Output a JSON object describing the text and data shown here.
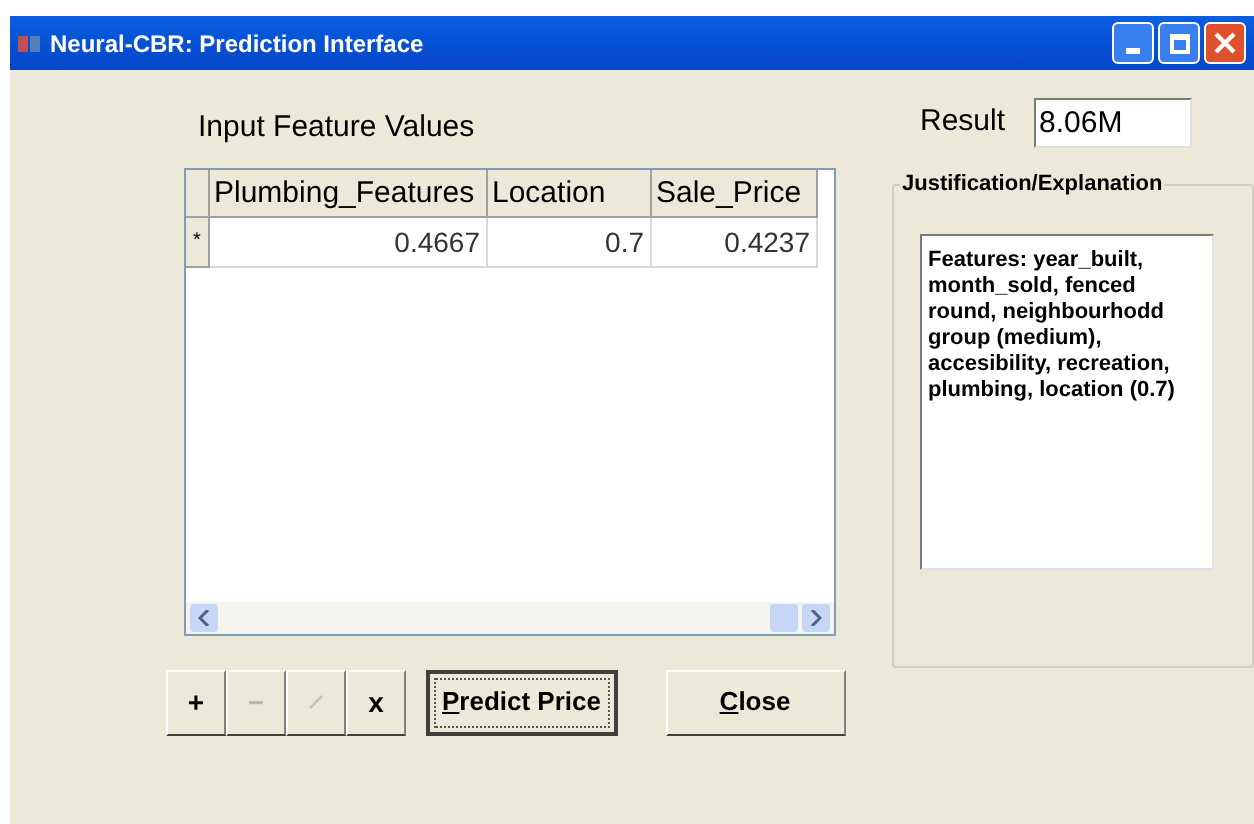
{
  "window": {
    "title": "Neural-CBR: Prediction Interface"
  },
  "input_section": {
    "title": "Input Feature Values"
  },
  "grid": {
    "columns": [
      "Plumbing_Features",
      "Location",
      "Sale_Price"
    ],
    "rows": [
      {
        "marker": "*",
        "cells": [
          "0.4667",
          "0.7",
          "0.4237"
        ]
      }
    ]
  },
  "result": {
    "label": "Result",
    "value": "8.06M"
  },
  "justification": {
    "title": "Justification/Explanation",
    "text": "Features: year_built, month_sold, fenced round, neighbourhodd group (medium), accesibility, recreation, plumbing, location (0.7)"
  },
  "toolbar": [
    {
      "kind": "text",
      "label": "+",
      "disabled": false
    },
    {
      "kind": "text",
      "label": "−",
      "disabled": true
    },
    {
      "kind": "edit",
      "disabled": true
    },
    {
      "kind": "text",
      "label": "x",
      "disabled": false
    }
  ],
  "buttons": [
    {
      "mnemonic": "P",
      "label_rest": "redict Price",
      "default": true
    },
    {
      "mnemonic": "C",
      "label_rest": "lose",
      "default": false
    }
  ]
}
